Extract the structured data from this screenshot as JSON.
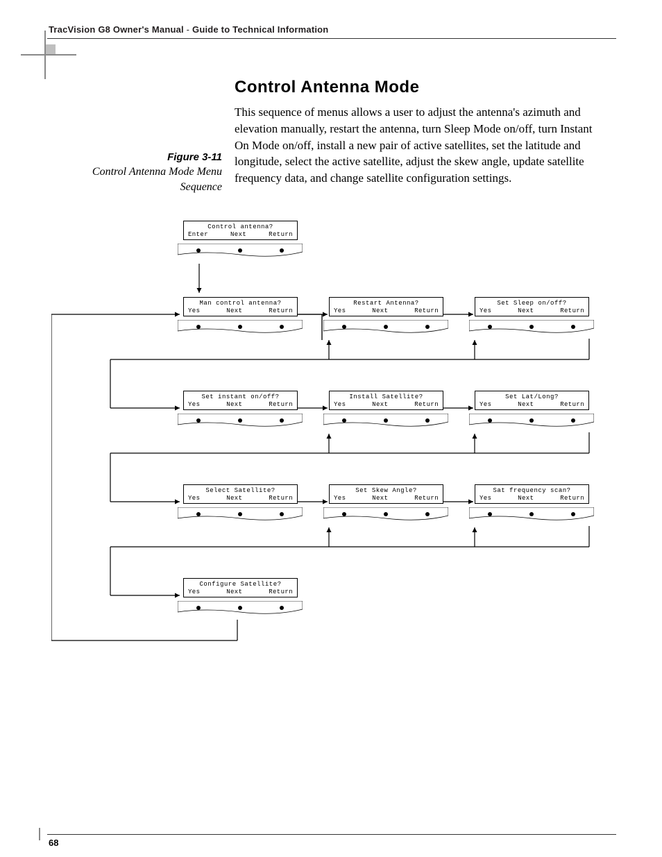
{
  "header": {
    "product": "TracVision G8 Owner's Manual",
    "section": "Guide to Technical Information"
  },
  "title": "Control Antenna Mode",
  "body": "This sequence of menus allows a user to adjust the antenna's azimuth and elevation manually, restart the antenna, turn Sleep Mode on/off, turn Instant On Mode on/off, install a new pair of active satellites, set the latitude and longitude, select the active satellite, adjust the skew angle, update satellite frequency data, and change satellite configuration settings.",
  "figure": {
    "number": "Figure 3-11",
    "caption": "Control Antenna Mode Menu Sequence"
  },
  "screens": {
    "s0": {
      "title": "Control antenna?",
      "b1": "Enter",
      "b2": "Next",
      "b3": "Return"
    },
    "s1": {
      "title": "Man control antenna?",
      "b1": "Yes",
      "b2": "Next",
      "b3": "Return"
    },
    "s2": {
      "title": "Restart Antenna?",
      "b1": "Yes",
      "b2": "Next",
      "b3": "Return"
    },
    "s3": {
      "title": "Set Sleep on/off?",
      "b1": "Yes",
      "b2": "Next",
      "b3": "Return"
    },
    "s4": {
      "title": "Set instant on/off?",
      "b1": "Yes",
      "b2": "Next",
      "b3": "Return"
    },
    "s5": {
      "title": "Install Satellite?",
      "b1": "Yes",
      "b2": "Next",
      "b3": "Return"
    },
    "s6": {
      "title": "Set Lat/Long?",
      "b1": "Yes",
      "b2": "Next",
      "b3": "Return"
    },
    "s7": {
      "title": "Select Satellite?",
      "b1": "Yes",
      "b2": "Next",
      "b3": "Return"
    },
    "s8": {
      "title": "Set Skew Angle?",
      "b1": "Yes",
      "b2": "Next",
      "b3": "Return"
    },
    "s9": {
      "title": "Sat frequency scan?",
      "b1": "Yes",
      "b2": "Next",
      "b3": "Return"
    },
    "s10": {
      "title": "Configure Satellite?",
      "b1": "Yes",
      "b2": "Next",
      "b3": "Return"
    }
  },
  "page_number": "68"
}
